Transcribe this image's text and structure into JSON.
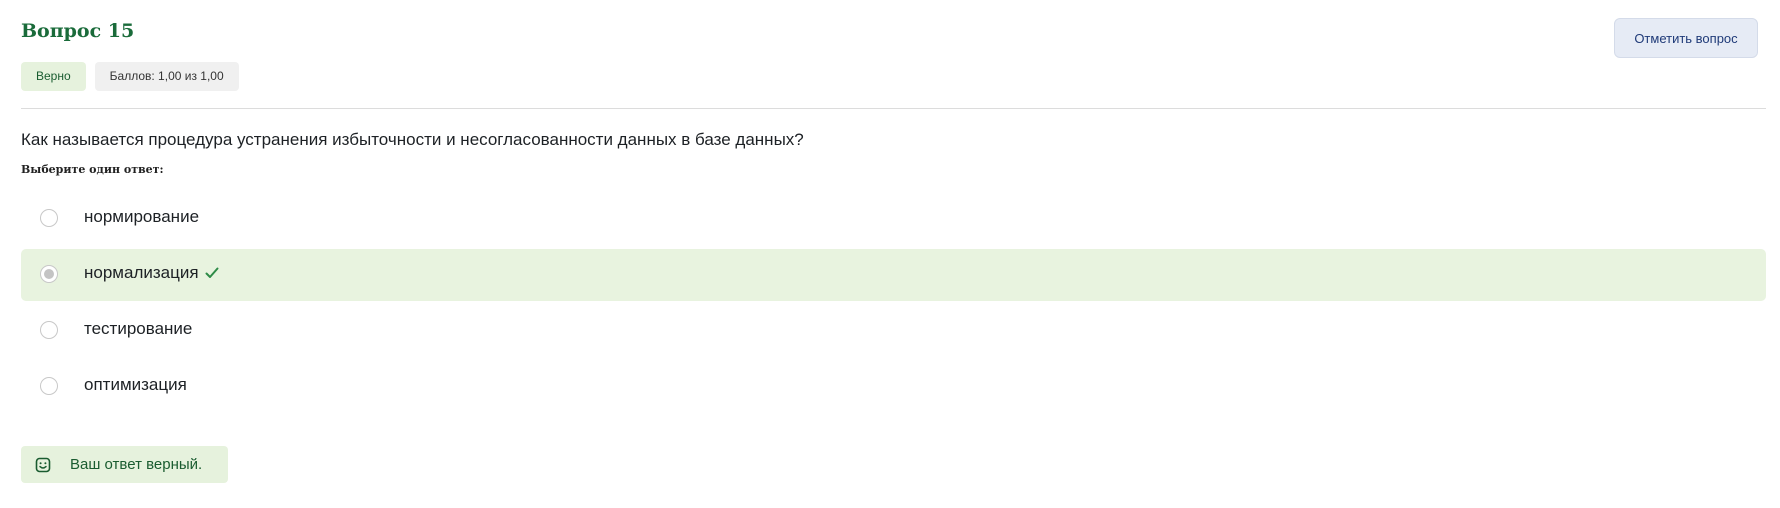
{
  "question": {
    "title": "Вопрос 15",
    "status": "Верно",
    "points": "Баллов: 1,00 из 1,00",
    "flag_label": "Отметить вопрос",
    "text": "Как называется процедура устранения избыточности и несогласованности данных в базе данных?",
    "prompt": "Выберите один ответ:",
    "answers": [
      {
        "label": "нормирование",
        "selected": false,
        "correct": false
      },
      {
        "label": "нормализация",
        "selected": true,
        "correct": true
      },
      {
        "label": "тестирование",
        "selected": false,
        "correct": false
      },
      {
        "label": "оптимизация",
        "selected": false,
        "correct": false
      }
    ],
    "feedback": "Ваш ответ верный."
  },
  "colors": {
    "title": "#1a6b3a",
    "correct_bg": "#e8f3df",
    "check": "#2e8b47",
    "flag_bg": "#e6ebf5",
    "flag_text": "#1f3a78"
  },
  "icons": {
    "correct_mark": "check-icon",
    "feedback": "smile-icon"
  }
}
